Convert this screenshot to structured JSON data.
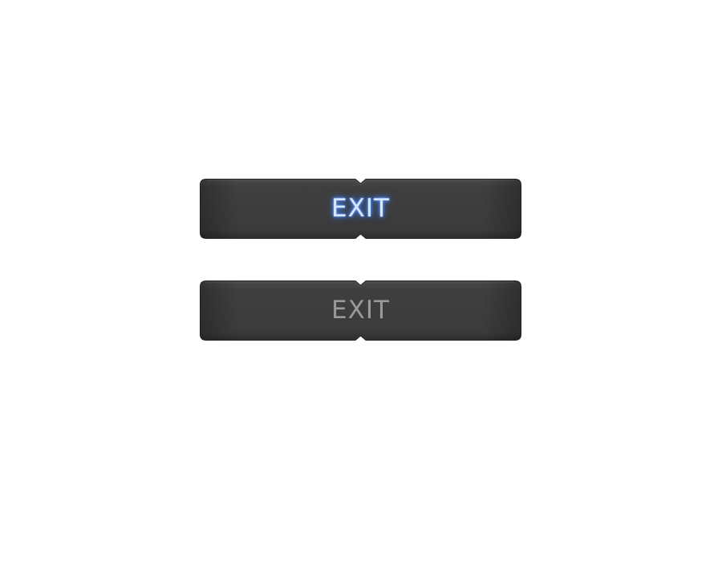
{
  "buttons": [
    {
      "label": "EXIT",
      "state": "hover"
    },
    {
      "label": "EXIT",
      "state": "normal"
    }
  ],
  "colors": {
    "background": "#ffffff",
    "button_body": "#3d3d3d",
    "button_edge": "#2a2a2a",
    "hover_glow": "#4a86f0",
    "hover_text": "#d6e6ff",
    "normal_text": "#9a9a9a"
  }
}
